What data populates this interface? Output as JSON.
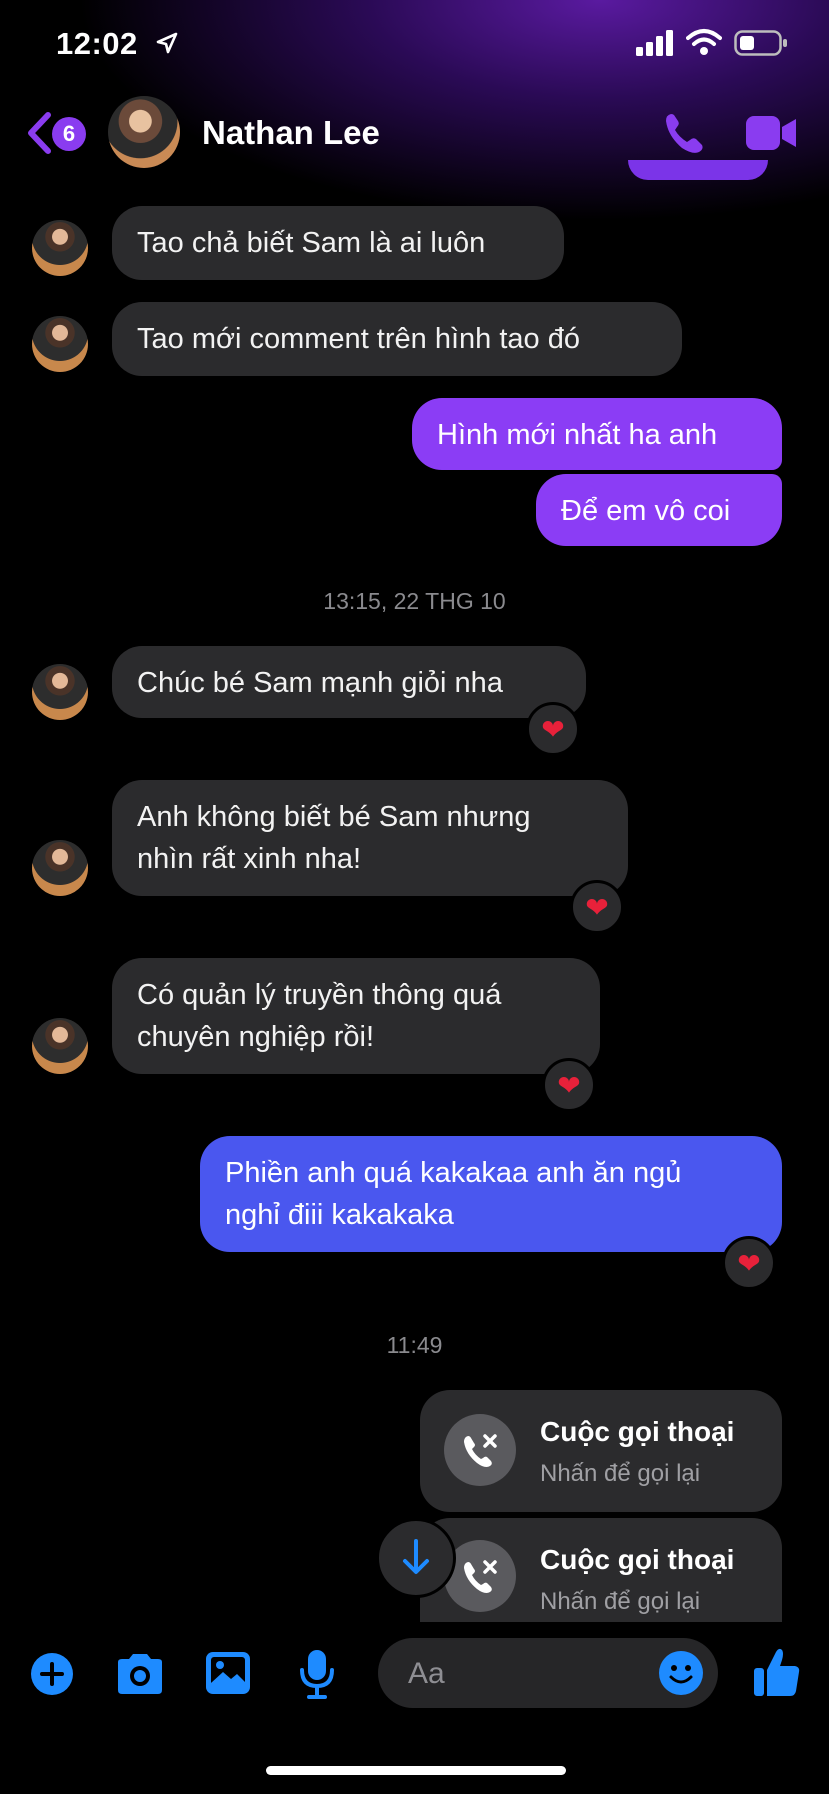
{
  "status_bar": {
    "time": "12:02"
  },
  "header": {
    "unread_count": "6",
    "contact_name": "Nathan Lee",
    "icons": [
      "back-chevron-icon",
      "phone-icon",
      "video-camera-icon"
    ]
  },
  "messages": [
    {
      "text": "Tao chả biết Sam là ai luôn"
    },
    {
      "text": "Tao mới comment trên hình tao đó"
    },
    {
      "text": "Hình mới nhất ha anh"
    },
    {
      "text": "Để em vô coi"
    },
    {
      "text": "Chúc bé Sam mạnh giỏi nha"
    },
    {
      "line1": "Anh không biết bé Sam nhưng",
      "line2": "nhìn rất xinh nha!"
    },
    {
      "line1": "Có quản lý truyền thông quá",
      "line2": "chuyên nghiệp rồi!"
    },
    {
      "line1": "Phiền anh quá kakakaa anh ăn ngủ",
      "line2": "nghỉ điii kakakaka"
    }
  ],
  "timestamps": [
    "13:15, 22 THG 10",
    "11:49"
  ],
  "reaction": "❤",
  "calls": [
    {
      "title": "Cuộc gọi thoại",
      "subtitle": "Nhấn để gọi lại"
    },
    {
      "title": "Cuộc gọi thoại",
      "subtitle": "Nhấn để gọi lại"
    }
  ],
  "composer": {
    "placeholder": "Aa"
  },
  "colors": {
    "accent": "#8a3cf0",
    "outgoing_purple": "#8b3df5",
    "outgoing_blue": "#4a57ef",
    "incoming_bg": "#2b2b2d",
    "toolbar_blue": "#1e8bff"
  }
}
